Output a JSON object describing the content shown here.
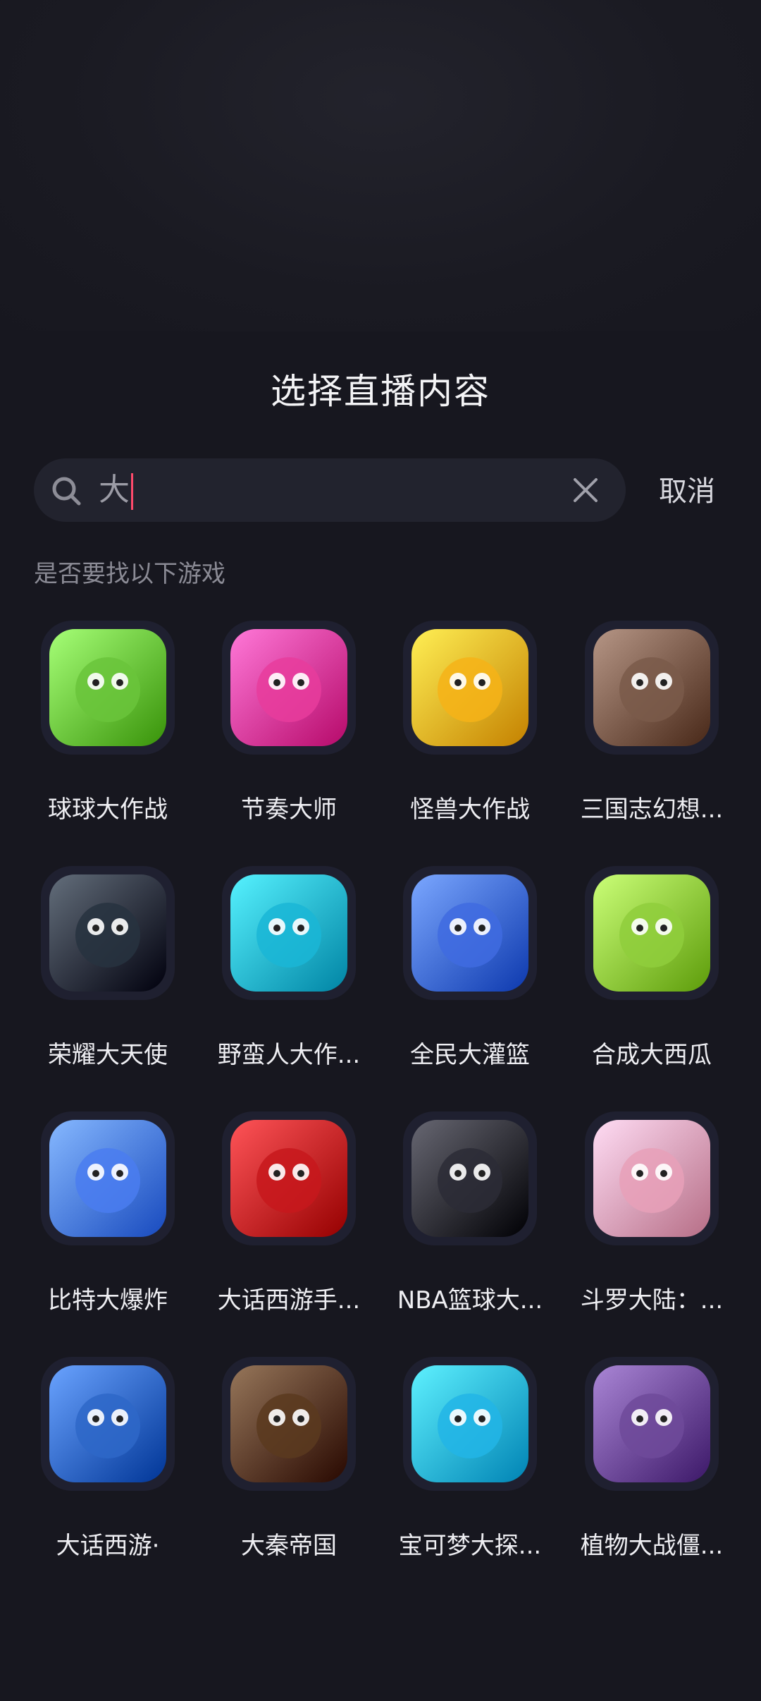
{
  "header": {
    "title": "选择直播内容"
  },
  "search": {
    "value": "大",
    "cancel_label": "取消"
  },
  "hint": "是否要找以下游戏",
  "games": [
    {
      "name": "球球大作战",
      "icon": "ball-battle-icon",
      "color": "#6ac43b"
    },
    {
      "name": "节奏大师",
      "icon": "rhythm-master-icon",
      "color": "#e83c9c"
    },
    {
      "name": "怪兽大作战",
      "icon": "monster-battle-icon",
      "color": "#f6b318"
    },
    {
      "name": "三国志幻想...",
      "icon": "three-kingdoms-icon",
      "color": "#7a5a4a"
    },
    {
      "name": "荣耀大天使",
      "icon": "glory-archangel-icon",
      "color": "#27323f"
    },
    {
      "name": "野蛮人大作...",
      "icon": "barbarian-battle-icon",
      "color": "#1ab6d6"
    },
    {
      "name": "全民大灌篮",
      "icon": "slam-dunk-icon",
      "color": "#3f6be0"
    },
    {
      "name": "合成大西瓜",
      "icon": "watermelon-icon",
      "color": "#8fce3c"
    },
    {
      "name": "比特大爆炸",
      "icon": "bit-explosion-icon",
      "color": "#4a7cf0"
    },
    {
      "name": "大话西游手...",
      "icon": "westward-journey-icon",
      "color": "#c7181c"
    },
    {
      "name": "NBA篮球大...",
      "icon": "nba-basketball-icon",
      "color": "#2b2b36"
    },
    {
      "name": "斗罗大陆：...",
      "icon": "douluo-icon",
      "color": "#e8a0b8"
    },
    {
      "name": "大话西游·",
      "icon": "westward-return-icon",
      "color": "#2e67c8"
    },
    {
      "name": "大秦帝国",
      "icon": "qin-empire-icon",
      "color": "#5a3a1e"
    },
    {
      "name": "宝可梦大探...",
      "icon": "pokemon-quest-icon",
      "color": "#22b5e6"
    },
    {
      "name": "植物大战僵...",
      "icon": "plants-zombies-icon",
      "color": "#6e4a9a"
    }
  ]
}
